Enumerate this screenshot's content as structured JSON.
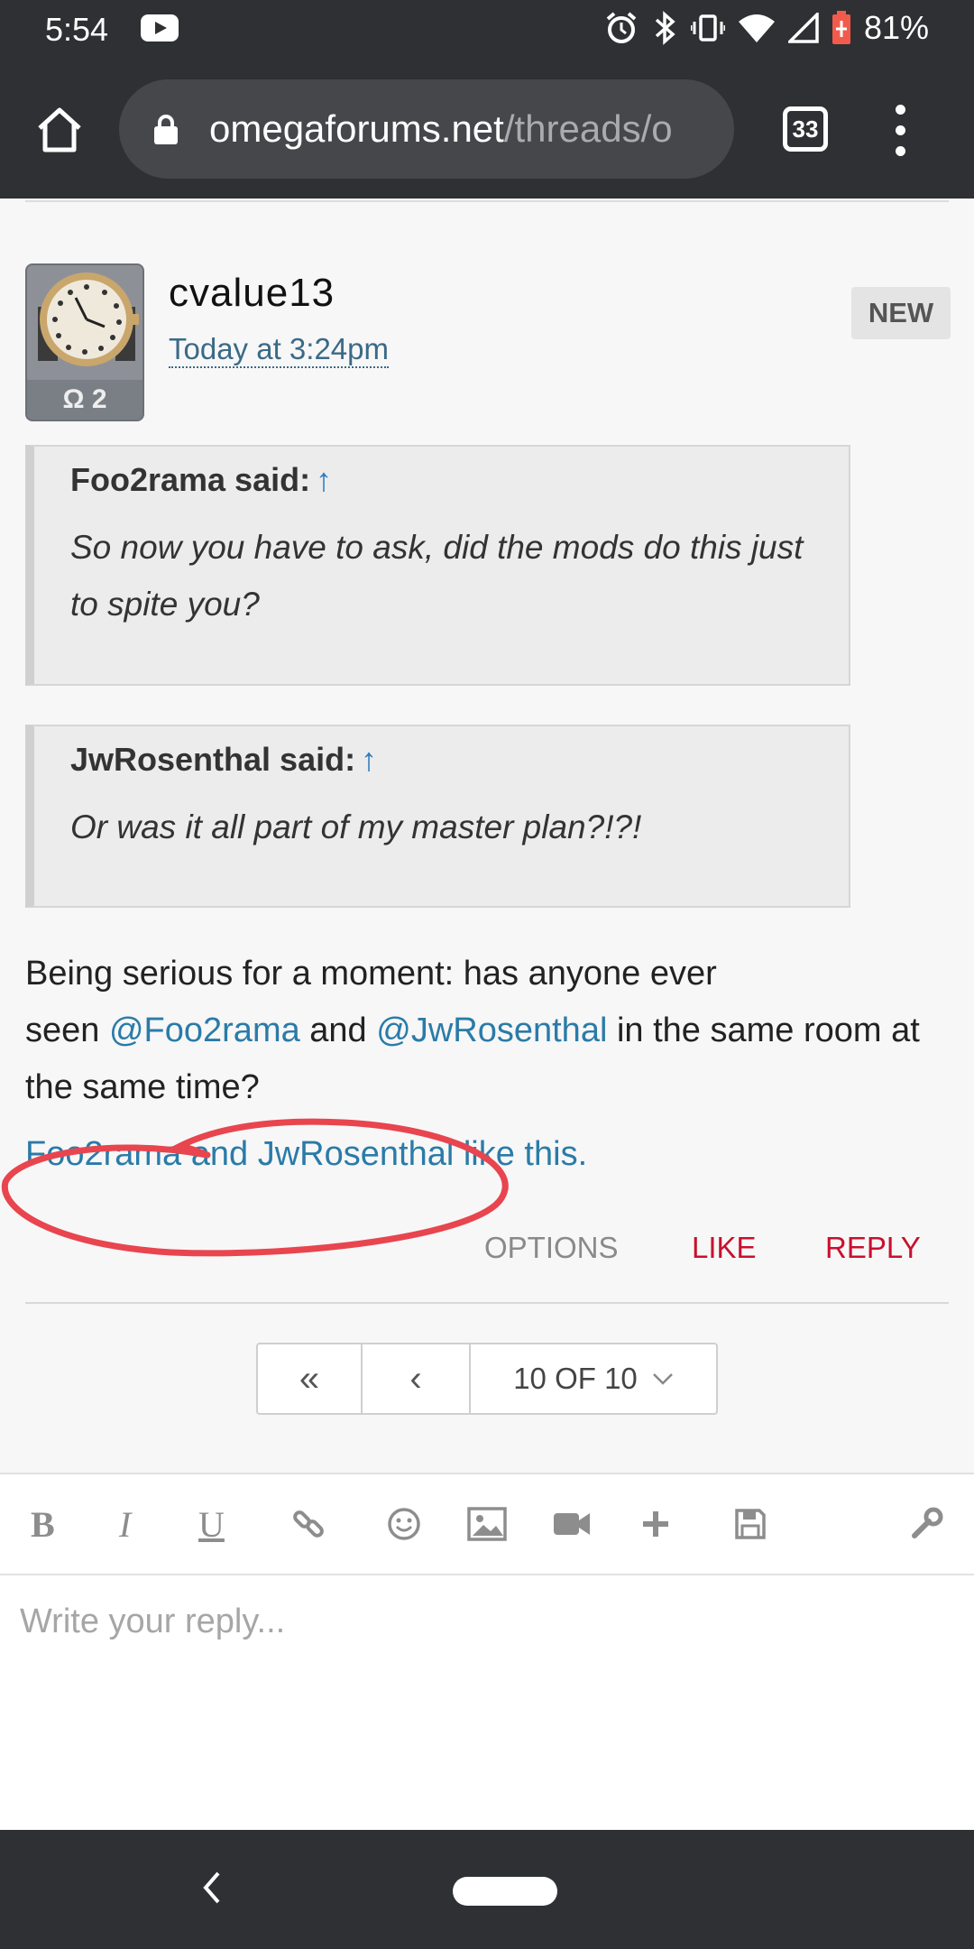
{
  "status_bar": {
    "time": "5:54",
    "battery": "81%",
    "icons": [
      "youtube-icon",
      "alarm-icon",
      "bluetooth-icon",
      "vibrate-icon",
      "wifi-icon",
      "signal-icon",
      "battery-icon"
    ]
  },
  "browser": {
    "url_domain": "omegaforums.net",
    "url_path": "/threads/o",
    "tab_count": "33"
  },
  "post": {
    "username": "cvalue13",
    "timestamp": "Today at 3:24pm",
    "badge": "NEW",
    "avatar_label": "Ω 2",
    "quotes": [
      {
        "author": "Foo2rama said:",
        "arrow": "↑",
        "body": "So now you have to ask, did the mods do this just to spite you?"
      },
      {
        "author": "JwRosenthal said:",
        "arrow": "↑",
        "body": "Or was it all part of my master plan?!?!"
      }
    ],
    "body_line1": "Being serious for a moment: has anyone ever",
    "body_seen": "seen ",
    "mention1": "@Foo2rama",
    "body_and": " and ",
    "mention2": "@JwRosenthal",
    "body_tail": " in the same room at the same time?",
    "likes_user1": "Foo2rama",
    "likes_and": " and ",
    "likes_user2": "JwRosenthal",
    "likes_suffix": " like this.",
    "actions": {
      "options": "OPTIONS",
      "like": "LIKE",
      "reply": "REPLY"
    }
  },
  "pagination": {
    "first": "«",
    "prev": "‹",
    "current": "10 OF 10"
  },
  "editor": {
    "tools": [
      "B",
      "I",
      "U"
    ],
    "placeholder": "Write your reply..."
  },
  "colors": {
    "chrome": "#2f3033",
    "link": "#2a7ba8",
    "action_red": "#c8102e",
    "annotation_circle": "#e8454f"
  }
}
